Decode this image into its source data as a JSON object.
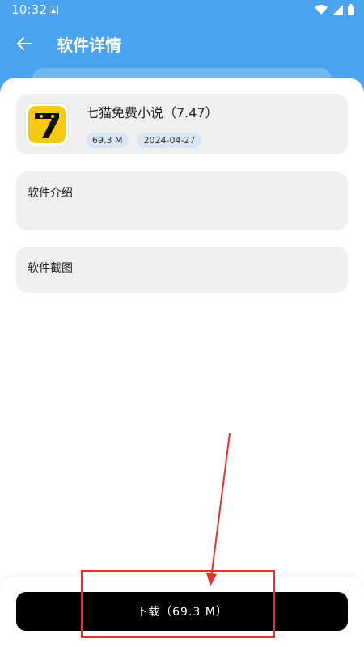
{
  "status_bar": {
    "time": "10:32"
  },
  "toolbar": {
    "title": "软件详情"
  },
  "app": {
    "name": "七猫免费小说（7.47）",
    "size": "69.3 M",
    "date": "2024-04-27",
    "icon_glyph": "7"
  },
  "sections": {
    "intro_label": "软件介绍",
    "screenshots_label": "软件截图"
  },
  "download": {
    "label": "下载（69.3 M）"
  },
  "colors": {
    "header": "#4aa3ee",
    "card": "#efefef",
    "button": "#000000",
    "annotation": "#e8302a",
    "icon_bg": "#f6c90e"
  },
  "icons": [
    "notification-icon",
    "wifi-icon",
    "signal-icon",
    "battery-icon",
    "back-arrow-icon"
  ]
}
